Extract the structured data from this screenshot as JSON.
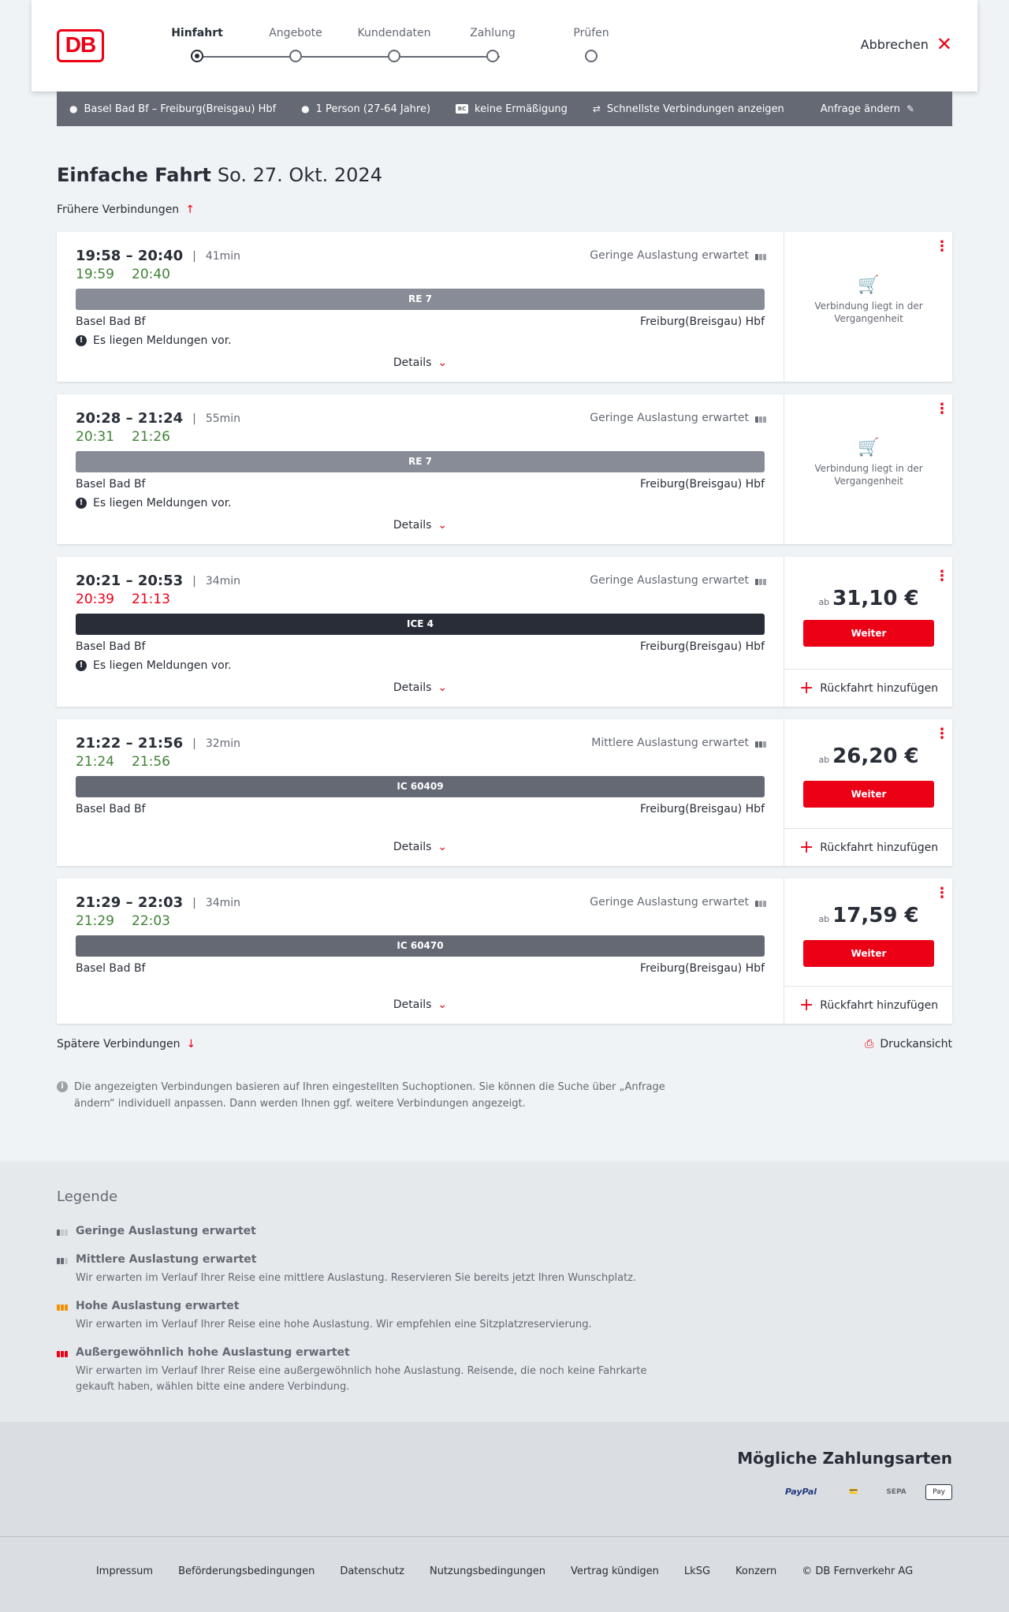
{
  "header": {
    "logo": "DB",
    "steps": [
      "Hinfahrt",
      "Angebote",
      "Kundendaten",
      "Zahlung",
      "Prüfen"
    ],
    "active_step": 0,
    "cancel_label": "Abbrechen"
  },
  "query": {
    "route": "Basel Bad Bf – Freiburg(Breisgau) Hbf",
    "passengers": "1 Person (27-64 Jahre)",
    "bc_badge": "BC",
    "discount": "keine Ermäßigung",
    "fastest": "Schnellste Verbindungen anzeigen",
    "edit_label": "Anfrage ändern"
  },
  "page": {
    "title": "Einfache Fahrt",
    "date": "So. 27. Okt. 2024",
    "earlier_label": "Frühere Verbindungen",
    "later_label": "Spätere Verbindungen",
    "print_label": "Druckansicht",
    "info_text": "Die angezeigten Verbindungen basieren auf Ihren eingestellten Suchoptionen. Sie können die Suche über „Anfrage ändern“ individuell anpassen. Dann werden Ihnen ggf. weitere Verbindungen angezeigt."
  },
  "connections": [
    {
      "times": "19:58 – 20:40",
      "duration": "41min",
      "rt_dep": "19:59",
      "rt_arr": "20:40",
      "rt_dep_late": false,
      "rt_arr_late": false,
      "load": "Geringe Auslastung erwartet",
      "train": "RE 7",
      "train_color": "#878c96",
      "from": "Basel Bad Bf",
      "to": "Freiburg(Breisgau) Hbf",
      "message": "Es liegen Meldungen vor.",
      "details": "Details",
      "past": "Verbindung liegt in der Vergangenheit"
    },
    {
      "times": "20:28 – 21:24",
      "duration": "55min",
      "rt_dep": "20:31",
      "rt_arr": "21:26",
      "rt_dep_late": false,
      "rt_arr_late": false,
      "load": "Geringe Auslastung erwartet",
      "train": "RE 7",
      "train_color": "#878c96",
      "from": "Basel Bad Bf",
      "to": "Freiburg(Breisgau) Hbf",
      "message": "Es liegen Meldungen vor.",
      "details": "Details",
      "past": "Verbindung liegt in der Vergangenheit"
    },
    {
      "times": "20:21 – 20:53",
      "duration": "34min",
      "rt_dep": "20:39",
      "rt_arr": "21:13",
      "rt_dep_late": true,
      "rt_arr_late": true,
      "load": "Geringe Auslastung erwartet",
      "train": "ICE 4",
      "train_color": "#282d37",
      "from": "Basel Bad Bf",
      "to": "Freiburg(Breisgau) Hbf",
      "message": "Es liegen Meldungen vor.",
      "details": "Details",
      "price_prefix": "ab",
      "price": "31,10 €",
      "button": "Weiter",
      "return_label": "Rückfahrt hinzufügen"
    },
    {
      "times": "21:22 – 21:56",
      "duration": "32min",
      "rt_dep": "21:24",
      "rt_arr": "21:56",
      "rt_dep_late": false,
      "rt_arr_late": false,
      "load": "Mittlere Auslastung erwartet",
      "train": "IC 60409",
      "train_color": "#646973",
      "from": "Basel Bad Bf",
      "to": "Freiburg(Breisgau) Hbf",
      "details": "Details",
      "price_prefix": "ab",
      "price": "26,20 €",
      "button": "Weiter",
      "return_label": "Rückfahrt hinzufügen"
    },
    {
      "times": "21:29 – 22:03",
      "duration": "34min",
      "rt_dep": "21:29",
      "rt_arr": "22:03",
      "rt_dep_late": false,
      "rt_arr_late": false,
      "load": "Geringe Auslastung erwartet",
      "train": "IC 60470",
      "train_color": "#646973",
      "from": "Basel Bad Bf",
      "to": "Freiburg(Breisgau) Hbf",
      "details": "Details",
      "price_prefix": "ab",
      "price": "17,59 €",
      "button": "Weiter",
      "return_label": "Rückfahrt hinzufügen"
    }
  ],
  "legend": {
    "title": "Legende",
    "items": [
      {
        "title": "Geringe Auslastung erwartet",
        "text": "",
        "color": "#9ea2a8"
      },
      {
        "title": "Mittlere Auslastung erwartet",
        "text": "Wir erwarten im Verlauf Ihrer Reise eine mittlere Auslastung. Reservieren Sie bereits jetzt Ihren Wunschplatz.",
        "color": "#646973"
      },
      {
        "title": "Hohe Auslastung erwartet",
        "text": "Wir erwarten im Verlauf Ihrer Reise eine hohe Auslastung. Wir empfehlen eine Sitzplatzreservierung.",
        "color": "#f39200"
      },
      {
        "title": "Außergewöhnlich hohe Auslastung erwartet",
        "text": "Wir erwarten im Verlauf Ihrer Reise eine außergewöhnlich hohe Auslastung. Reisende, die noch keine Fahrkarte gekauft haben, wählen bitte eine andere Verbindung.",
        "color": "#ec0016"
      }
    ]
  },
  "payment": {
    "title": "Mögliche Zahlungsarten",
    "methods": [
      "PayPal",
      "Kreditkarte",
      "SEPA",
      "Apple Pay"
    ],
    "paypal_label": "PayPal",
    "sepa_label": "SEPA",
    "applepay_label": "Pay"
  },
  "footer": {
    "links": [
      "Impressum",
      "Beförderungsbedingungen",
      "Datenschutz",
      "Nutzungsbedingungen",
      "Vertrag kündigen",
      "LkSG",
      "Konzern",
      "© DB Fernverkehr AG"
    ]
  }
}
